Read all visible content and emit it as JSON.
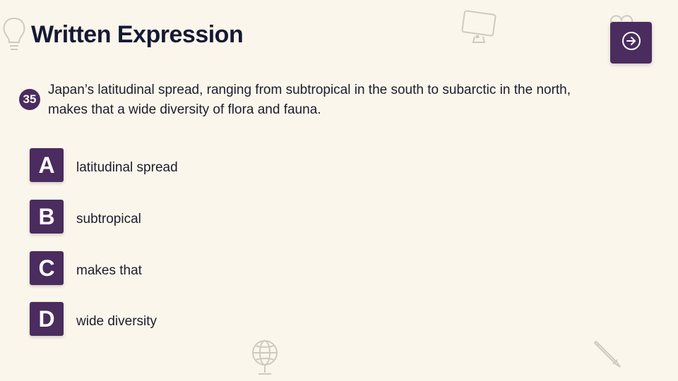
{
  "header": {
    "title": "Written Expression"
  },
  "question": {
    "number": "35",
    "text": "Japan’s latitudinal spread, ranging from subtropical in the south to subarctic in the north, makes that a wide diversity of flora and fauna."
  },
  "options": [
    {
      "letter": "A",
      "text": "latitudinal spread"
    },
    {
      "letter": "B",
      "text": "subtropical"
    },
    {
      "letter": "C",
      "text": "makes that"
    },
    {
      "letter": "D",
      "text": "wide diversity"
    }
  ],
  "icons": {
    "next": "arrow-right-circle-icon",
    "decorations": [
      "lightbulb-icon",
      "monitor-icon",
      "heart-icon",
      "globe-icon",
      "pencil-icon"
    ]
  },
  "colors": {
    "accent": "#4a2c5e",
    "background": "#fbf6ec",
    "title": "#151a33"
  }
}
